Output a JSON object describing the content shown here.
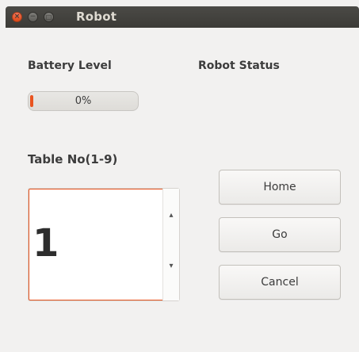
{
  "window": {
    "title": "Robot"
  },
  "battery": {
    "label": "Battery Level",
    "percent_text": "0%",
    "value": 0
  },
  "status": {
    "label": "Robot Status"
  },
  "table": {
    "label": "Table No(1-9)",
    "value": "1"
  },
  "buttons": {
    "home": "Home",
    "go": "Go",
    "cancel": "Cancel"
  },
  "icons": {
    "close": "close-icon",
    "minimize": "minimize-icon",
    "maximize": "maximize-icon",
    "up": "chevron-up-icon",
    "down": "chevron-down-icon"
  },
  "colors": {
    "accent": "#e95420",
    "titlebar": "#3c3b37",
    "background": "#f2f1f0"
  }
}
